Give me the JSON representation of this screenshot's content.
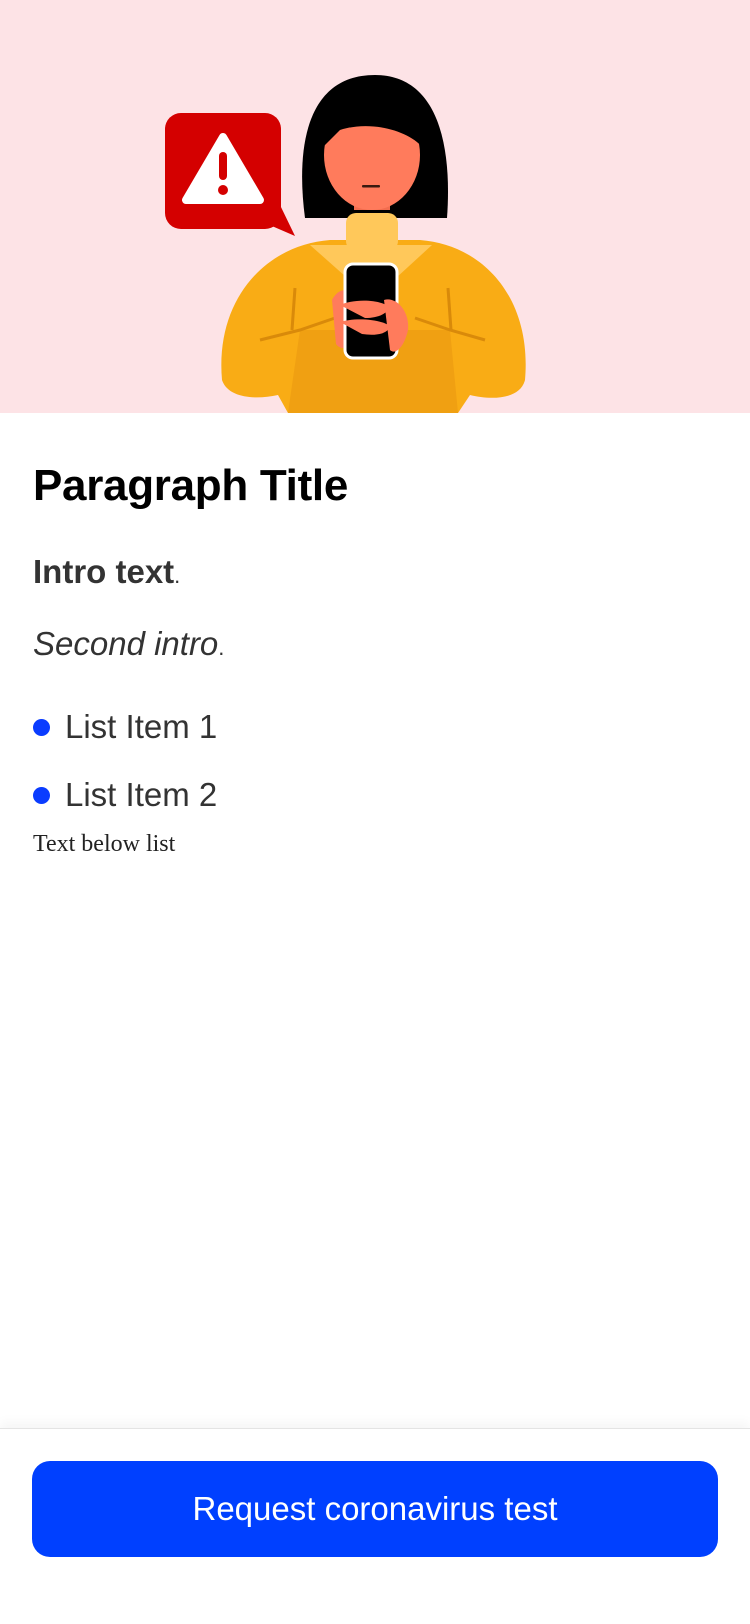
{
  "hero": {
    "background": "#fde3e6",
    "illustration": "person-holding-phone-with-warning-icon"
  },
  "content": {
    "title": "Paragraph Title",
    "intro_bold": "Intro text",
    "intro_suffix": ".",
    "second_italic": "Second intro",
    "second_suffix": ".",
    "list": [
      {
        "label": "List Item 1"
      },
      {
        "label": "List Item 2"
      }
    ],
    "below_list": "Text below list"
  },
  "footer": {
    "cta_label": "Request coronavirus test"
  },
  "colors": {
    "accent": "#0040ff",
    "bullet": "#0a3cff",
    "warning": "#d40000"
  }
}
